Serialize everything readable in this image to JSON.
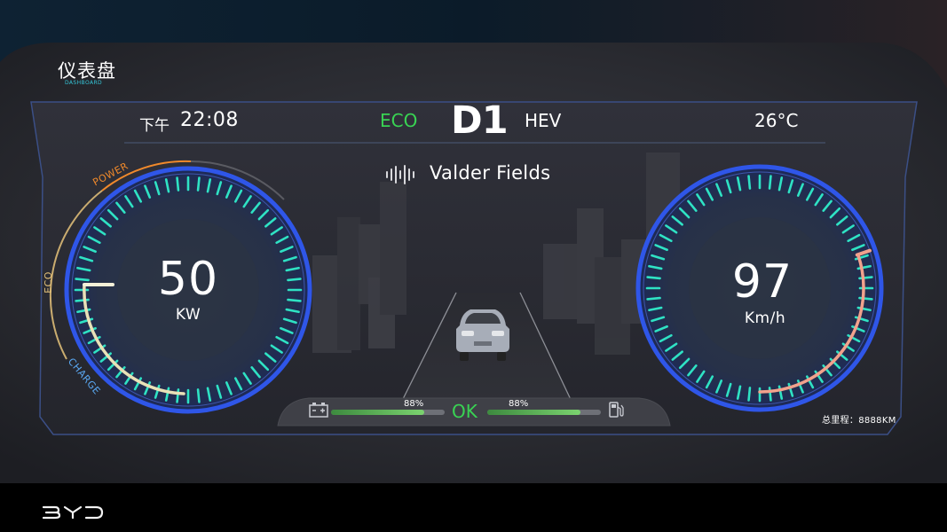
{
  "header": {
    "title": "仪表盘",
    "subtitle": "DASHBOARD"
  },
  "status": {
    "time_prefix": "下午",
    "time": "22:08",
    "mode": "ECO",
    "gear": "D1",
    "drive": "HEV",
    "temperature": "26°C"
  },
  "media": {
    "track": "Valder Fields",
    "icon": "sound-wave-icon"
  },
  "power_gauge": {
    "value": "50",
    "unit": "KW",
    "labels": [
      "POWER",
      "ECO",
      "CHARGE"
    ],
    "needle_fraction": 0.33
  },
  "speed_gauge": {
    "value": "97",
    "unit": "Km/h",
    "fill_fraction": 0.48
  },
  "battery": {
    "percent": "88%",
    "level": 0.82,
    "icon": "battery-icon"
  },
  "fuel": {
    "percent": "88%",
    "level": 0.82,
    "icon": "fuel-pump-icon"
  },
  "system_status": "OK",
  "odometer": "总里程：8888KM",
  "colors": {
    "eco_green": "#39d353",
    "tick_cyan": "#2fe2c4",
    "ring_blue": "#2f56e8",
    "speed_arc": "#f2a18c",
    "power_orange": "#f0892b"
  },
  "brand": "BYD"
}
